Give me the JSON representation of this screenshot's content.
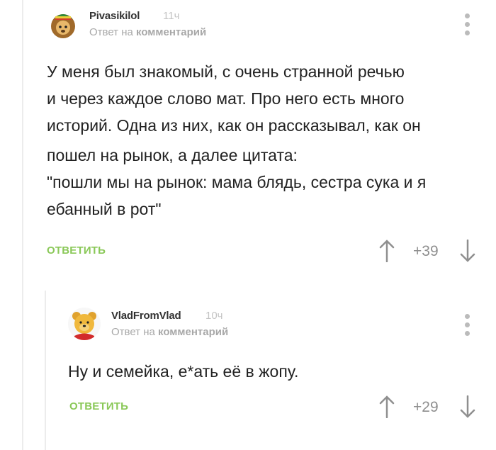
{
  "comments": [
    {
      "username": "Pivasikilol",
      "time": "11ч",
      "reply_prefix": "Ответ на",
      "reply_target": "комментарий",
      "lines": [
        "У меня был знакомый, с очень странной речью",
        "и через каждое слово мат. Про него есть много",
        "историй. Одна из них, как он рассказывал, как он",
        "пошел на рынок, а далее цитата:",
        "\"пошли мы на рынок: мама блядь, сестра сука и я",
        "ебанный в рот\""
      ],
      "reply_label": "ОТВЕТИТЬ",
      "rating": "+39",
      "avatar_icon": "lion-avatar-icon"
    },
    {
      "username": "VladFromVlad",
      "time": "10ч",
      "reply_prefix": "Ответ на",
      "reply_target": "комментарий",
      "lines": [
        "Ну и семейка, е*ать её в жопу."
      ],
      "reply_label": "ОТВЕТИТЬ",
      "rating": "+29",
      "avatar_icon": "winnie-the-pooh-avatar-icon"
    }
  ],
  "colors": {
    "accent_green": "#8ac858",
    "muted_gray": "#a8a8a8",
    "thread_line": "#ececec"
  }
}
